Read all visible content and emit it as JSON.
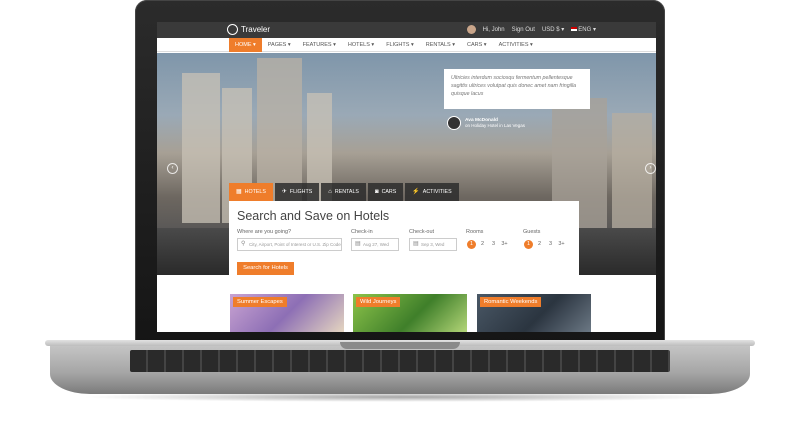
{
  "topbar": {
    "logo_text": "Traveler",
    "user_name": "Hi, John",
    "sign_out": "Sign Out",
    "currency": "USD $",
    "language": "ENG"
  },
  "nav": {
    "items": [
      "HOME",
      "PAGES",
      "FEATURES",
      "HOTELS",
      "FLIGHTS",
      "RENTALS",
      "CARS",
      "ACTIVITIES"
    ],
    "active": "HOME"
  },
  "hero": {
    "quote": "Ultricies interdum sociosqu fermentum pellentesque sagittis ultrices volutpat quis donec amet nam fringilla quisque lacus",
    "author_name": "Ava McDonald",
    "author_caption": "on Holiday Hotel in Las Vegas"
  },
  "search": {
    "tabs": [
      {
        "label": "HOTELS",
        "icon": "building-icon"
      },
      {
        "label": "FLIGHTS",
        "icon": "plane-icon"
      },
      {
        "label": "RENTALS",
        "icon": "home-icon"
      },
      {
        "label": "CARS",
        "icon": "car-icon"
      },
      {
        "label": "ACTIVITIES",
        "icon": "bolt-icon"
      }
    ],
    "title": "Search and Save on Hotels",
    "where_label": "Where are you going?",
    "where_placeholder": "City, Airport, Point of Interest or U.S. Zip Code",
    "checkin_label": "Check-in",
    "checkin_value": "Aug 27, Wed",
    "checkout_label": "Check-out",
    "checkout_value": "Sep 3, Wed",
    "rooms_label": "Rooms",
    "rooms_options": [
      "1",
      "2",
      "3",
      "3+"
    ],
    "guests_label": "Guests",
    "guests_options": [
      "1",
      "2",
      "3",
      "3+"
    ],
    "button": "Search for Hotels"
  },
  "cards": [
    "Summer Escapes",
    "Wild Journeys",
    "Romantic Weekends"
  ],
  "colors": {
    "accent": "#ef7d2b",
    "topbar": "#3a3a3a"
  }
}
